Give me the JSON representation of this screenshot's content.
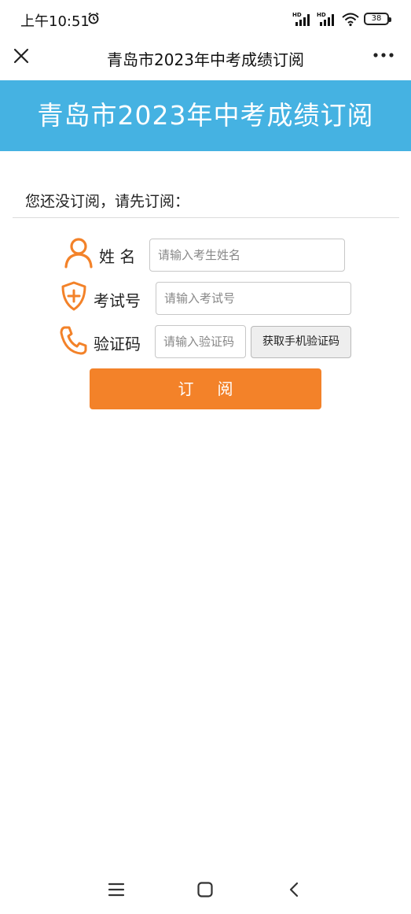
{
  "status_bar": {
    "time": "上午10:51",
    "battery": "38",
    "icons": [
      "alarm-icon",
      "signal-hd-icon",
      "signal-hd-icon",
      "wifi-icon",
      "battery-icon"
    ]
  },
  "title_bar": {
    "title": "青岛市2023年中考成绩订阅",
    "close_icon": "close-icon",
    "more_icon": "more-icon"
  },
  "banner": {
    "text": "青岛市2023年中考成绩订阅"
  },
  "prompt": "您还没订阅，请先订阅：",
  "form": {
    "name": {
      "label": "姓 名",
      "placeholder": "请输入考生姓名",
      "icon": "user-icon"
    },
    "exam_no": {
      "label": "考试号",
      "placeholder": "请输入考试号",
      "icon": "shield-plus-icon"
    },
    "code": {
      "label": "验证码",
      "placeholder": "请输入验证码",
      "icon": "phone-icon",
      "button": "获取手机验证码"
    },
    "submit": "订阅"
  },
  "colors": {
    "banner": "#45b2e2",
    "accent": "#f38229",
    "icon": "#f38229"
  },
  "nav": {
    "icons": [
      "menu-icon",
      "home-icon",
      "back-icon"
    ]
  }
}
